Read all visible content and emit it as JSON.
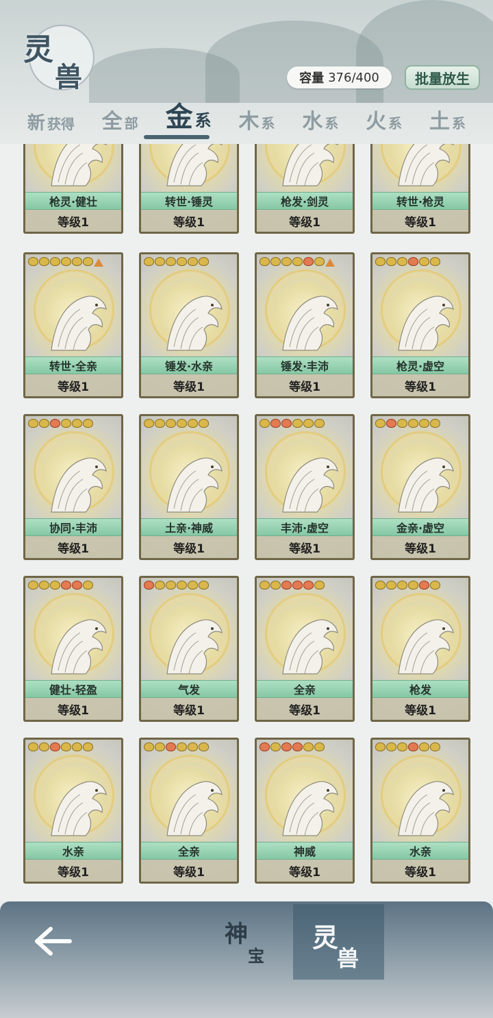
{
  "header": {
    "title_char1": "灵",
    "title_char2": "兽",
    "capacity_label": "容量",
    "capacity_value": "376/400",
    "release_button": "批量放生"
  },
  "tabs": [
    {
      "big": "新",
      "small": "获得",
      "active": false
    },
    {
      "big": "全",
      "small": "部",
      "active": false
    },
    {
      "big": "金",
      "small": "系",
      "active": true
    },
    {
      "big": "木",
      "small": "系",
      "active": false
    },
    {
      "big": "水",
      "small": "系",
      "active": false
    },
    {
      "big": "火",
      "small": "系",
      "active": false
    },
    {
      "big": "土",
      "small": "系",
      "active": false
    }
  ],
  "cards": [
    {
      "name": "枪灵·健壮",
      "level": "等级1",
      "paws": [],
      "marker": false
    },
    {
      "name": "转世·锤灵",
      "level": "等级1",
      "paws": [],
      "marker": false
    },
    {
      "name": "枪发·剑灵",
      "level": "等级1",
      "paws": [],
      "marker": false
    },
    {
      "name": "转世·枪灵",
      "level": "等级1",
      "paws": [],
      "marker": false
    },
    {
      "name": "转世·全亲",
      "level": "等级1",
      "paws": [
        "g",
        "g",
        "g",
        "g",
        "g",
        "g"
      ],
      "marker": true
    },
    {
      "name": "锤发·水亲",
      "level": "等级1",
      "paws": [
        "g",
        "g",
        "g",
        "g",
        "g",
        "g"
      ],
      "marker": false
    },
    {
      "name": "锤发·丰沛",
      "level": "等级1",
      "paws": [
        "g",
        "g",
        "g",
        "g",
        "r",
        "g"
      ],
      "marker": true
    },
    {
      "name": "枪灵·虚空",
      "level": "等级1",
      "paws": [
        "g",
        "g",
        "g",
        "r",
        "g",
        "g"
      ],
      "marker": false
    },
    {
      "name": "协同·丰沛",
      "level": "等级1",
      "paws": [
        "g",
        "g",
        "r",
        "g",
        "g",
        "g"
      ],
      "marker": false
    },
    {
      "name": "土亲·神威",
      "level": "等级1",
      "paws": [
        "g",
        "g",
        "g",
        "g",
        "g",
        "g"
      ],
      "marker": false
    },
    {
      "name": "丰沛·虚空",
      "level": "等级1",
      "paws": [
        "g",
        "r",
        "r",
        "g",
        "g",
        "g"
      ],
      "marker": false
    },
    {
      "name": "金亲·虚空",
      "level": "等级1",
      "paws": [
        "g",
        "r",
        "g",
        "g",
        "g",
        "g"
      ],
      "marker": false
    },
    {
      "name": "健壮·轻盈",
      "level": "等级1",
      "paws": [
        "g",
        "g",
        "g",
        "r",
        "r",
        "g"
      ],
      "marker": false
    },
    {
      "name": "气发",
      "level": "等级1",
      "paws": [
        "r",
        "g",
        "g",
        "g",
        "g",
        "g"
      ],
      "marker": false
    },
    {
      "name": "全亲",
      "level": "等级1",
      "paws": [
        "g",
        "g",
        "r",
        "r",
        "r",
        "g"
      ],
      "marker": false
    },
    {
      "name": "枪发",
      "level": "等级1",
      "paws": [
        "g",
        "g",
        "g",
        "g",
        "r",
        "g"
      ],
      "marker": false
    },
    {
      "name": "水亲",
      "level": "等级1",
      "paws": [
        "g",
        "g",
        "r",
        "g",
        "g",
        "g"
      ],
      "marker": false
    },
    {
      "name": "全亲",
      "level": "等级1",
      "paws": [
        "g",
        "g",
        "r",
        "g",
        "g",
        "g"
      ],
      "marker": false
    },
    {
      "name": "神威",
      "level": "等级1",
      "paws": [
        "r",
        "g",
        "r",
        "r",
        "g",
        "g"
      ],
      "marker": false
    },
    {
      "name": "水亲",
      "level": "等级1",
      "paws": [
        "g",
        "g",
        "g",
        "r",
        "g",
        "g"
      ],
      "marker": false
    }
  ],
  "bottom_nav": {
    "shenbao_a": "神",
    "shenbao_b": "宝",
    "lingshou_a": "灵",
    "lingshou_b": "兽"
  },
  "colors": {
    "card_frame": "#6f6647",
    "name_bar": "#85c8a5",
    "active_tab": "#2e4654",
    "nav_active": "#4b6576"
  }
}
